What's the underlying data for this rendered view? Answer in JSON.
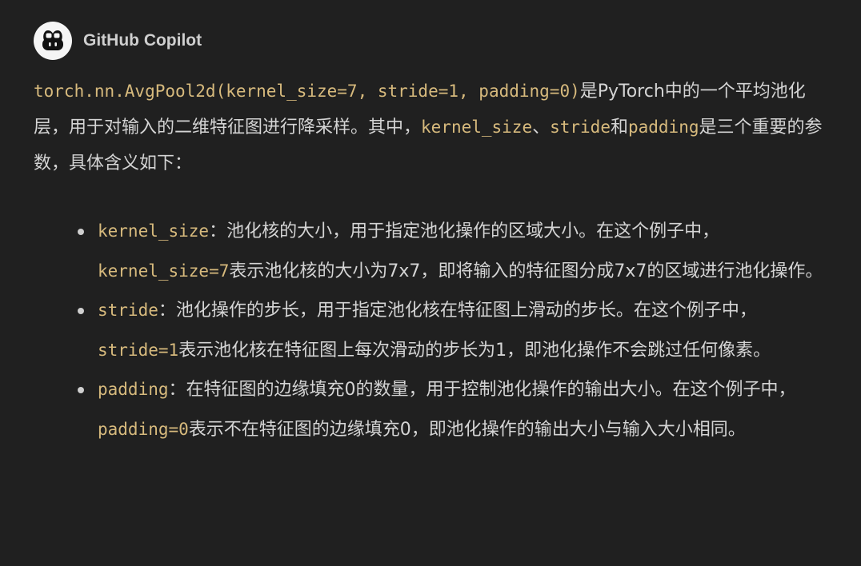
{
  "header": {
    "author": "GitHub Copilot",
    "avatar_icon": "copilot-icon"
  },
  "message": {
    "intro": {
      "code": "torch.nn.AvgPool2d(kernel_size=7, stride=1, padding=0)",
      "text1": "是PyTorch中的一个平均池化层，用于对输入的二维特征图进行降采样。其中，",
      "code2": "kernel_size",
      "sep1": "、",
      "code3": "stride",
      "sep2": "和",
      "code4": "padding",
      "text2": "是三个重要的参数，具体含义如下："
    },
    "items": [
      {
        "term": "kernel_size",
        "desc": "：池化核的大小，用于指定池化操作的区域大小。在这个例子中，",
        "example": "kernel_size=7",
        "rest": "表示池化核的大小为7x7，即将输入的特征图分成7x7的区域进行池化操作。"
      },
      {
        "term": "stride",
        "desc": "：池化操作的步长，用于指定池化核在特征图上滑动的步长。在这个例子中，",
        "example": "stride=1",
        "rest": "表示池化核在特征图上每次滑动的步长为1，即池化操作不会跳过任何像素。"
      },
      {
        "term": "padding",
        "desc": "：在特征图的边缘填充0的数量，用于控制池化操作的输出大小。在这个例子中，",
        "example": "padding=0",
        "rest": "表示不在特征图的边缘填充0，即池化操作的输出大小与输入大小相同。"
      }
    ]
  },
  "colors": {
    "background": "#202020",
    "text": "#d4d4d4",
    "code": "#d7ba7d"
  }
}
